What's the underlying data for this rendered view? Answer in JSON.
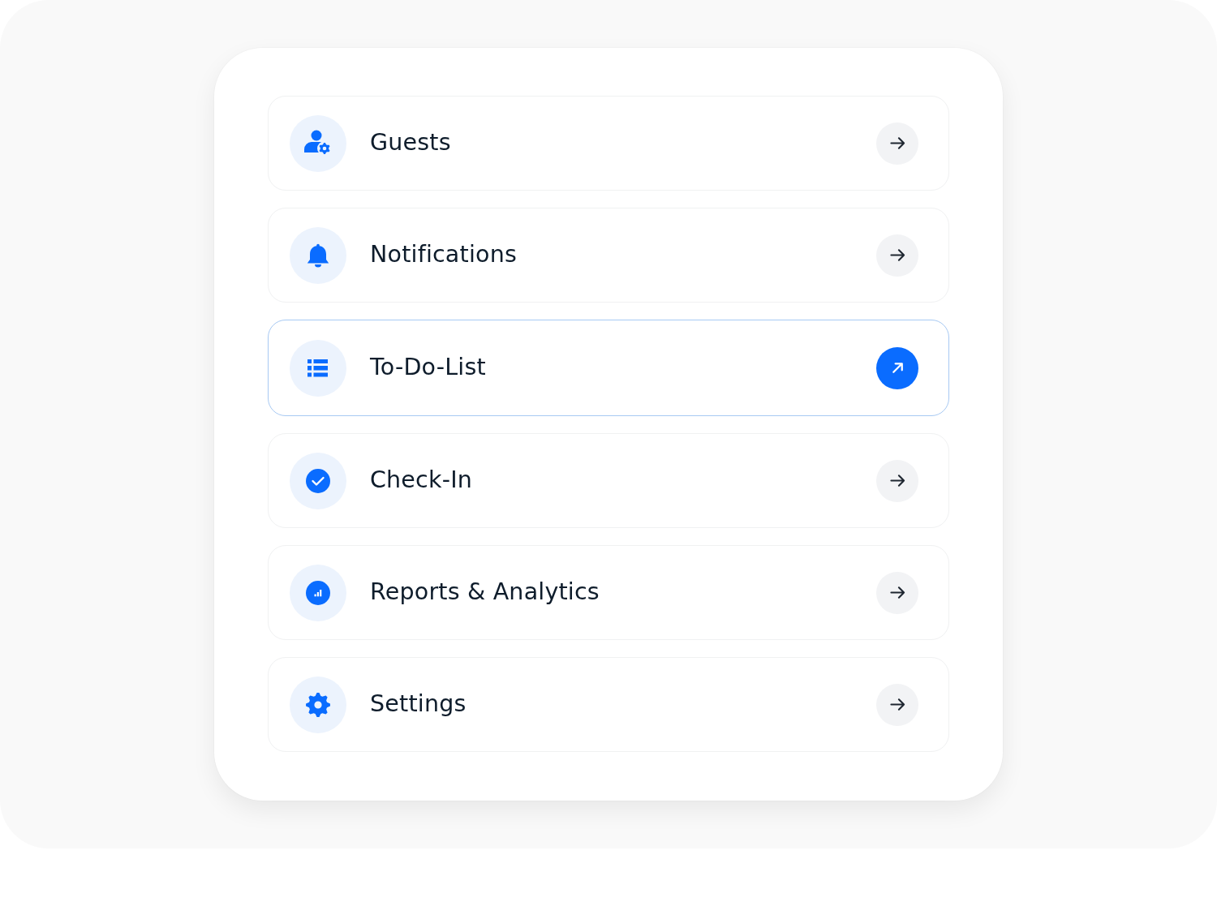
{
  "menu": {
    "items": [
      {
        "label": "Guests",
        "selected": false
      },
      {
        "label": "Notifications",
        "selected": false
      },
      {
        "label": "To-Do-List",
        "selected": true
      },
      {
        "label": "Check-In",
        "selected": false
      },
      {
        "label": "Reports & Analytics",
        "selected": false
      },
      {
        "label": "Settings",
        "selected": false
      }
    ]
  }
}
